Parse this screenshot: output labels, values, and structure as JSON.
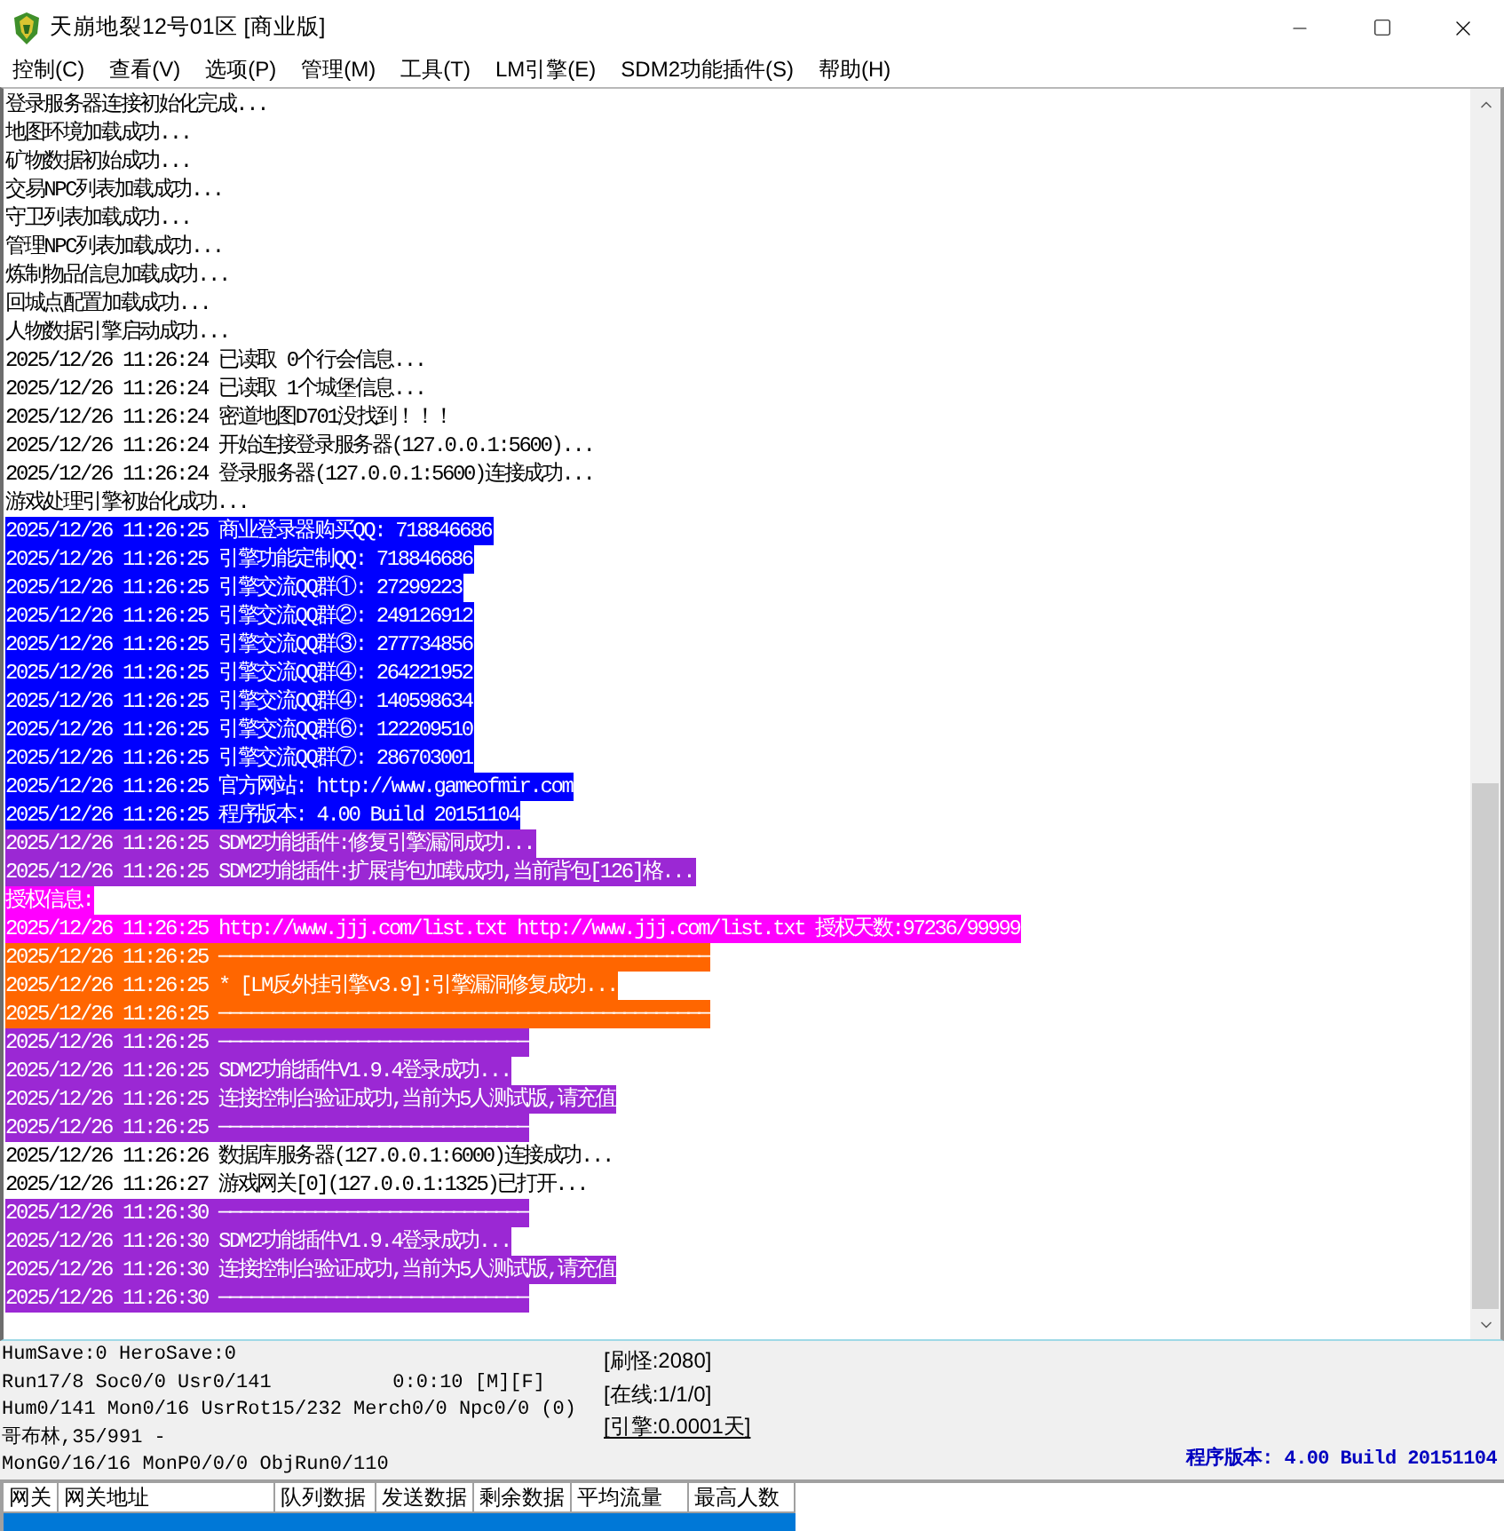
{
  "window": {
    "title": "天崩地裂12号01区 [商业版]"
  },
  "menu": [
    "控制(C)",
    "查看(V)",
    "选项(P)",
    "管理(M)",
    "工具(T)",
    "LM引擎(E)",
    "SDM2功能插件(S)",
    "帮助(H)"
  ],
  "log": {
    "lines": [
      {
        "text": "登录服务器连接初始化完成..."
      },
      {
        "text": "地图环境加载成功..."
      },
      {
        "text": "矿物数据初始成功..."
      },
      {
        "text": "交易NPC列表加载成功..."
      },
      {
        "text": "守卫列表加载成功..."
      },
      {
        "text": "管理NPC列表加载成功..."
      },
      {
        "text": "炼制物品信息加载成功..."
      },
      {
        "text": "回城点配置加载成功..."
      },
      {
        "text": "人物数据引擎启动成功..."
      },
      {
        "text": "2025/12/26 11:26:24 已读取 0个行会信息..."
      },
      {
        "text": "2025/12/26 11:26:24 已读取 1个城堡信息..."
      },
      {
        "text": "2025/12/26 11:26:24 密道地图D701没找到！！！"
      },
      {
        "text": "2025/12/26 11:26:24 开始连接登录服务器(127.0.0.1:5600)..."
      },
      {
        "text": "2025/12/26 11:26:24 登录服务器(127.0.0.1:5600)连接成功..."
      },
      {
        "text": "游戏处理引擎初始化成功..."
      },
      {
        "text": "2025/12/26 11:26:25 商业登录器购买QQ: 718846686",
        "color": "#0000ff"
      },
      {
        "text": "2025/12/26 11:26:25 引擎功能定制QQ: 718846686",
        "color": "#0000ff"
      },
      {
        "text": "2025/12/26 11:26:25 引擎交流QQ群①: 27299223",
        "color": "#0000ff"
      },
      {
        "text": "2025/12/26 11:26:25 引擎交流QQ群②: 249126912",
        "color": "#0000ff"
      },
      {
        "text": "2025/12/26 11:26:25 引擎交流QQ群③: 277734856",
        "color": "#0000ff"
      },
      {
        "text": "2025/12/26 11:26:25 引擎交流QQ群④: 264221952",
        "color": "#0000ff"
      },
      {
        "text": "2025/12/26 11:26:25 引擎交流QQ群④: 140598634",
        "color": "#0000ff"
      },
      {
        "text": "2025/12/26 11:26:25 引擎交流QQ群⑥: 122209510",
        "color": "#0000ff"
      },
      {
        "text": "2025/12/26 11:26:25 引擎交流QQ群⑦: 286703001",
        "color": "#0000ff"
      },
      {
        "text": "2025/12/26 11:26:25 官方网站: http://www.gameofmir.com",
        "color": "#0000ff"
      },
      {
        "text": "2025/12/26 11:26:25 程序版本: 4.00 Build 20151104",
        "color": "#0000ff"
      },
      {
        "text": "2025/12/26 11:26:25 SDM2功能插件:修复引擎漏洞成功...",
        "color": "#9b28d4"
      },
      {
        "text": "2025/12/26 11:26:25 SDM2功能插件:扩展背包加载成功,当前背包[126]格...",
        "color": "#9b28d4"
      },
      {
        "text": "授权信息:",
        "color": "#ff00ff"
      },
      {
        "text": "2025/12/26 11:26:25 http://www.jjj.com/list.txt http://www.jjj.com/list.txt 授权天数:97236/99999",
        "color": "#ff00ff"
      },
      {
        "text": "2025/12/26 11:26:25 ──────────────────────────────────────────────",
        "color": "#ff6600"
      },
      {
        "text": "2025/12/26 11:26:25 * [LM反外挂引擎v3.9]:引擎漏洞修复成功...",
        "color": "#ff6600"
      },
      {
        "text": "2025/12/26 11:26:25 ──────────────────────────────────────────────",
        "color": "#ff6600"
      },
      {
        "text": "2025/12/26 11:26:25 ─────────────────────────────",
        "color": "#9b28d4"
      },
      {
        "text": "2025/12/26 11:26:25 SDM2功能插件V1.9.4登录成功...",
        "color": "#9b28d4"
      },
      {
        "text": "2025/12/26 11:26:25 连接控制台验证成功,当前为5人测试版,请充值",
        "color": "#9b28d4"
      },
      {
        "text": "2025/12/26 11:26:25 ─────────────────────────────",
        "color": "#9b28d4"
      },
      {
        "text": "2025/12/26 11:26:26 数据库服务器(127.0.0.1:6000)连接成功..."
      },
      {
        "text": "2025/12/26 11:26:27 游戏网关[0](127.0.0.1:1325)已打开..."
      },
      {
        "text": "2025/12/26 11:26:30 ─────────────────────────────",
        "color": "#9b28d4"
      },
      {
        "text": "2025/12/26 11:26:30 SDM2功能插件V1.9.4登录成功...",
        "color": "#9b28d4"
      },
      {
        "text": "2025/12/26 11:26:30 连接控制台验证成功,当前为5人测试版,请充值",
        "color": "#9b28d4"
      },
      {
        "text": "2025/12/26 11:26:30 ─────────────────────────────",
        "color": "#9b28d4"
      }
    ]
  },
  "status": {
    "rows": [
      [
        "HumSave:0 HeroSave:0"
      ],
      [
        "Run17/8 Soc0/0 Usr0/141",
        "0:0:10 [M][F]"
      ],
      [
        "Hum0/141 Mon0/16 UsrRot15/232 Merch0/0 Npc0/0 (0)"
      ],
      [
        "哥布林,35/991 -"
      ],
      [
        "MonG0/16/16 MonP0/0/0 ObjRun0/110"
      ]
    ],
    "counters": [
      {
        "text": "[刷怪:2080]",
        "underlined": false
      },
      {
        "text": "[在线:1/1/0]",
        "underlined": false
      },
      {
        "text": "[引擎:0.0001天]",
        "underlined": true
      }
    ],
    "version": "程序版本: 4.00 Build 20151104"
  },
  "gate_table": {
    "columns": [
      "网关",
      "网关地址",
      "队列数据",
      "发送数据",
      "剩余数据",
      "平均流量",
      "最高人数"
    ],
    "rows": [
      {
        "selected": true
      }
    ]
  }
}
